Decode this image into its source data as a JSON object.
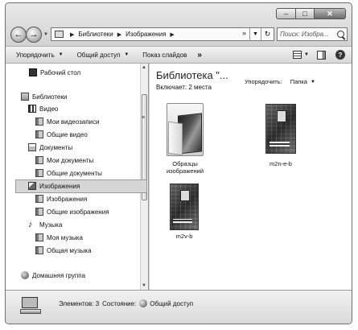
{
  "address": {
    "segments": [
      "Библиотеки",
      "Изображения"
    ],
    "more": "»"
  },
  "search": {
    "placeholder": "Поиск: Изобра..."
  },
  "toolbar": {
    "organize": "Упорядочить",
    "share": "Общий доступ",
    "slideshow": "Показ слайдов",
    "more": "»"
  },
  "sidebar": {
    "desktop": "Рабочий стол",
    "libraries": "Библиотеки",
    "video": "Видео",
    "my_videos": "Мои видеозаписи",
    "public_videos": "Общие видео",
    "documents": "Документы",
    "my_documents": "Мои документы",
    "public_documents": "Общие документы",
    "pictures": "Изображения",
    "my_pictures": "Изображения",
    "public_pictures": "Общие изображения",
    "music": "Музыка",
    "my_music": "Моя музыка",
    "public_music": "Общая музыка",
    "homegroup": "Домашняя группа"
  },
  "content": {
    "title": "Библиотека \"...",
    "includes_label": "Включает:",
    "includes_value": "2 места",
    "arrange_label": "Упорядочить:",
    "arrange_value": "Папка",
    "files": [
      {
        "name": "Образцы изображений",
        "icon": "folder-icon"
      },
      {
        "name": "m2n-e-b",
        "icon": "image-thumbnail"
      },
      {
        "name": "m2v-b",
        "icon": "image-thumbnail"
      }
    ]
  },
  "status": {
    "items_label": "Элементов: 3",
    "state_label": "Состояние:",
    "state_value": "Общий доступ"
  }
}
